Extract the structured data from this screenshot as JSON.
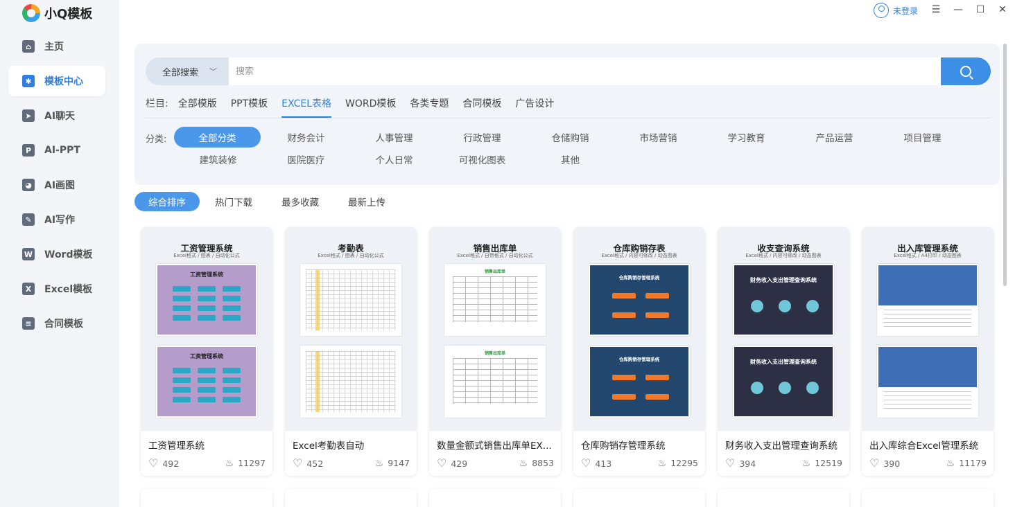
{
  "app": {
    "name": "小Q模板"
  },
  "sidebar": {
    "items": [
      {
        "label": "主页",
        "icon": "home-icon",
        "glyph": "⌂"
      },
      {
        "label": "模板中心",
        "icon": "puzzle-icon",
        "glyph": "✱",
        "active": true
      },
      {
        "label": "AI聊天",
        "icon": "send-icon",
        "glyph": "➤"
      },
      {
        "label": "AI-PPT",
        "icon": "ppt-icon",
        "glyph": "P"
      },
      {
        "label": "AI画图",
        "icon": "palette-icon",
        "glyph": "◕"
      },
      {
        "label": "AI写作",
        "icon": "write-icon",
        "glyph": "✎"
      },
      {
        "label": "Word模板",
        "icon": "word-icon",
        "glyph": "W"
      },
      {
        "label": "Excel模板",
        "icon": "excel-icon",
        "glyph": "X"
      },
      {
        "label": "合同模板",
        "icon": "contract-icon",
        "glyph": "≡"
      }
    ]
  },
  "topbar": {
    "user_label": "未登录"
  },
  "search": {
    "scope": "全部搜索",
    "placeholder": "搜索"
  },
  "columns": {
    "label": "栏目:",
    "tabs": [
      "全部模版",
      "PPT模板",
      "EXCEL表格",
      "WORD模板",
      "各类专题",
      "合同模板",
      "广告设计"
    ],
    "active_index": 2
  },
  "categories": {
    "label": "分类:",
    "items": [
      "全部分类",
      "财务会计",
      "人事管理",
      "行政管理",
      "仓储购销",
      "市场营销",
      "学习教育",
      "产品运营",
      "项目管理",
      "建筑装修",
      "医院医疗",
      "个人日常",
      "可视化图表",
      "其他"
    ],
    "active_index": 0
  },
  "sort": {
    "items": [
      "综合排序",
      "热门下载",
      "最多收藏",
      "最新上传"
    ],
    "active_index": 0
  },
  "cards": [
    {
      "thumb_title": "工资管理系统",
      "thumb_sub": "Excel格式 / 图表 / 自动化公式",
      "inner_title": "工资管理系统",
      "name": "工资管理系统",
      "likes": "492",
      "downloads": "11297",
      "style": "purple"
    },
    {
      "thumb_title": "考勤表",
      "thumb_sub": "Excel格式 / 图表 / 自动化公式",
      "name": "Excel考勤表自动",
      "likes": "452",
      "downloads": "9147",
      "style": "sheet"
    },
    {
      "thumb_title": "销售出库单",
      "thumb_sub": "Excel格式 / 自带格式 / 自动化公式",
      "inner_title": "销售出库单",
      "name": "数量金额式销售出库单EX...",
      "likes": "429",
      "downloads": "8853",
      "style": "green"
    },
    {
      "thumb_title": "仓库购销存表",
      "thumb_sub": "Excel格式 / 内容可修改 / 动态图表",
      "inner_title": "仓库购销存管理系统",
      "name": "仓库购销存管理系统",
      "likes": "413",
      "downloads": "12295",
      "style": "navy"
    },
    {
      "thumb_title": "收支查询系统",
      "thumb_sub": "Excel格式 / 内容可修改 / 动态图表",
      "inner_title": "财务收入支出管理查询系统",
      "name": "财务收入支出管理查询系统",
      "likes": "394",
      "downloads": "12519",
      "style": "dark"
    },
    {
      "thumb_title": "出入库管理系统",
      "thumb_sub": "Excel格式 / A4打印 / 动态图表",
      "name": "出入库综合Excel管理系统",
      "likes": "390",
      "downloads": "11179",
      "style": "blue"
    }
  ],
  "colors": {
    "accent": "#3d8fe6",
    "active_text": "#2f7fe0",
    "panel_bg": "#f1f4f8",
    "sidebar_bg": "#f3f5f8"
  }
}
